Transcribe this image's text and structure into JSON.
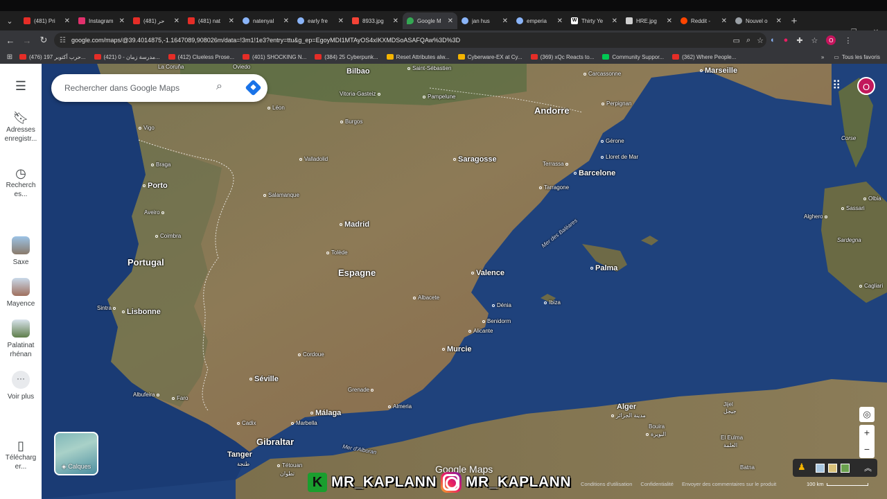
{
  "browser": {
    "tabs": [
      {
        "title": "(481) Pri",
        "favicon_color": "#e52d27"
      },
      {
        "title": "Instagram",
        "favicon_color": "#e1306c"
      },
      {
        "title": "(481) حر",
        "favicon_color": "#e52d27"
      },
      {
        "title": "(481) nat",
        "favicon_color": "#e52d27"
      },
      {
        "title": "natenyal",
        "favicon_color": "#8ab4f8"
      },
      {
        "title": "early fre",
        "favicon_color": "#8ab4f8"
      },
      {
        "title": "8933.jpg",
        "favicon_color": "#f44336"
      },
      {
        "title": "Google M",
        "favicon_color": "#34a853"
      },
      {
        "title": "jan hus",
        "favicon_color": "#8ab4f8"
      },
      {
        "title": "emperia",
        "favicon_color": "#8ab4f8"
      },
      {
        "title": "Thirty Ye",
        "favicon_color": "#ffffff"
      },
      {
        "title": "HRE.jpg",
        "favicon_color": "#cfcfcf"
      },
      {
        "title": "Reddit -",
        "favicon_color": "#ff4500"
      },
      {
        "title": "Nouvel o",
        "favicon_color": "#9aa0a6"
      }
    ],
    "active_tab": 7,
    "url": "google.com/maps/@39.4014875,-1.1647089,908026m/data=!3m1!1e3?entry=ttu&g_ep=EgoyMDI1MTAyOS4xIKXMDSoASAFQAw%3D%3D",
    "profile_initial": "O",
    "bookmarks": [
      {
        "label": "(476) حرب أكتوبر 197...",
        "color": "#e52d27"
      },
      {
        "label": "(421) مدرسة زمان - 0...",
        "color": "#e52d27"
      },
      {
        "label": "(412) Clueless Prose...",
        "color": "#e52d27"
      },
      {
        "label": "(401) SHOCKING N...",
        "color": "#e52d27"
      },
      {
        "label": "(384) 25 Cyberpunk...",
        "color": "#e52d27"
      },
      {
        "label": "Reset Attributes alw...",
        "color": "#f4b400"
      },
      {
        "label": "Cyberware-EX at Cy...",
        "color": "#f4b400"
      },
      {
        "label": "(369) xQc Reacts to...",
        "color": "#e52d27"
      },
      {
        "label": "Community Suppor...",
        "color": "#00c853"
      },
      {
        "label": "(362) Where People...",
        "color": "#e52d27"
      }
    ],
    "all_bookmarks": "Tous les favoris"
  },
  "sidebar": {
    "saved": "Adresses enregistr...",
    "recent": "Recherch es...",
    "places": [
      {
        "label": "Saxe",
        "color": "#7fa6c9"
      },
      {
        "label": "Mayence",
        "color": "#b58a79"
      },
      {
        "label": "Palatinat rhénan",
        "color": "#6f8c5a"
      }
    ],
    "more": "Voir plus",
    "download": "Télécharg er..."
  },
  "search": {
    "placeholder": "Rechercher dans Google Maps"
  },
  "avatar_initial": "O",
  "layers_label": "Calques",
  "logo": "Google Maps",
  "footer": {
    "terms": "Conditions d'utilisation",
    "privacy": "Confidentialité",
    "feedback": "Envoyer des commentaires sur le produit",
    "scale": "100 km"
  },
  "watermark": {
    "left": "MR_KAPLANN",
    "right": "MR_KAPLANN"
  },
  "map": {
    "countries": [
      {
        "name": "Portugal"
      },
      {
        "name": "Espagne"
      },
      {
        "name": "Andorre"
      }
    ],
    "cities": [
      {
        "name": "Bilbao"
      },
      {
        "name": "Saint-Sébastien"
      },
      {
        "name": "Carcassonne"
      },
      {
        "name": "Marseille"
      },
      {
        "name": "Vitoria-Gasteiz"
      },
      {
        "name": "Pampelune"
      },
      {
        "name": "Perpignan"
      },
      {
        "name": "Léon"
      },
      {
        "name": "Vigo"
      },
      {
        "name": "Burgos"
      },
      {
        "name": "Gérone"
      },
      {
        "name": "Lloret de Mar"
      },
      {
        "name": "Braga"
      },
      {
        "name": "Valladolid"
      },
      {
        "name": "Saragosse"
      },
      {
        "name": "Terrassa"
      },
      {
        "name": "Barcelone"
      },
      {
        "name": "Porto"
      },
      {
        "name": "Tarragone"
      },
      {
        "name": "Salamanque"
      },
      {
        "name": "Aveiro"
      },
      {
        "name": "Madrid"
      },
      {
        "name": "Coimbra"
      },
      {
        "name": "Tolède"
      },
      {
        "name": "Palma"
      },
      {
        "name": "Valence"
      },
      {
        "name": "Sintra"
      },
      {
        "name": "Lisbonne"
      },
      {
        "name": "Albacete"
      },
      {
        "name": "Ibiza"
      },
      {
        "name": "Dénia"
      },
      {
        "name": "Benidorm"
      },
      {
        "name": "Alicante"
      },
      {
        "name": "Murcie"
      },
      {
        "name": "Cordoue"
      },
      {
        "name": "Séville"
      },
      {
        "name": "Grenade"
      },
      {
        "name": "Albufeira"
      },
      {
        "name": "Faro"
      },
      {
        "name": "Almeria"
      },
      {
        "name": "Málaga"
      },
      {
        "name": "Marbella"
      },
      {
        "name": "Cadix"
      },
      {
        "name": "Gibraltar"
      },
      {
        "name": "Tanger"
      },
      {
        "name": "طنجة"
      },
      {
        "name": "Tétouan"
      },
      {
        "name": "تطوان"
      },
      {
        "name": "Alger"
      },
      {
        "name": "مدينة الجزائر"
      },
      {
        "name": "Bouira"
      },
      {
        "name": "البويرة"
      },
      {
        "name": "Jijel"
      },
      {
        "name": "جيجل"
      },
      {
        "name": "El Eulma"
      },
      {
        "name": "العلمة"
      },
      {
        "name": "Batna"
      },
      {
        "name": "Corse"
      },
      {
        "name": "Olbia"
      },
      {
        "name": "Sassari"
      },
      {
        "name": "Alghero"
      },
      {
        "name": "Sardegna"
      },
      {
        "name": "Cagliari"
      },
      {
        "name": "La Coruña"
      },
      {
        "name": "Oviedo"
      }
    ],
    "seas": [
      {
        "name": "Mer des Baléares"
      },
      {
        "name": "Mer d'Alboran"
      }
    ]
  }
}
